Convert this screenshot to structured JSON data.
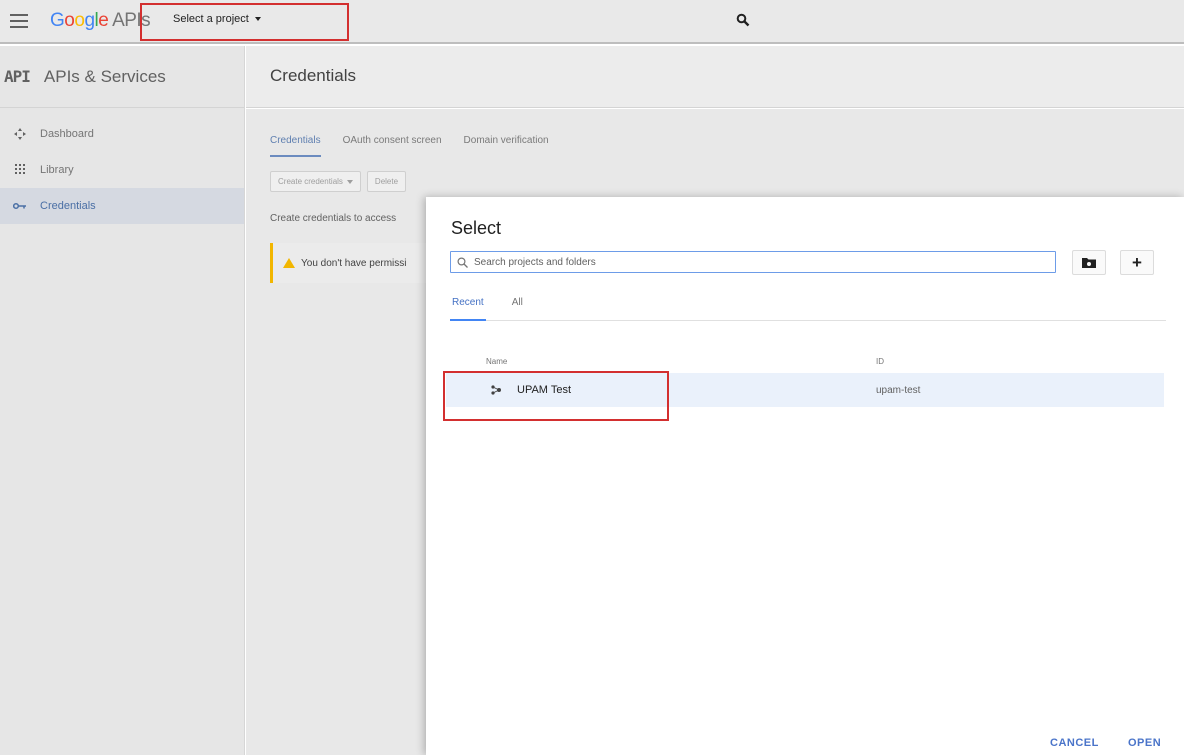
{
  "header": {
    "brand_google": [
      "G",
      "o",
      "o",
      "g",
      "l",
      "e"
    ],
    "brand_suffix": "APIs",
    "project_picker_label": "Select a project"
  },
  "sidebar": {
    "logo_text": "API",
    "title": "APIs & Services",
    "items": [
      {
        "label": "Dashboard",
        "icon": "dashboard-icon"
      },
      {
        "label": "Library",
        "icon": "library-icon"
      },
      {
        "label": "Credentials",
        "icon": "key-icon",
        "active": true
      }
    ]
  },
  "main": {
    "title": "Credentials",
    "tabs": [
      "Credentials",
      "OAuth consent screen",
      "Domain verification"
    ],
    "active_tab": "Credentials",
    "toolbar": {
      "create_label": "Create credentials",
      "delete_label": "Delete"
    },
    "hint": "Create credentials to access",
    "warning": "You don't have permissi"
  },
  "dialog": {
    "title": "Select",
    "search": {
      "placeholder": "Search projects and folders",
      "value": ""
    },
    "tabs": [
      "Recent",
      "All"
    ],
    "active_tab": "Recent",
    "columns": {
      "name": "Name",
      "id": "ID"
    },
    "projects": [
      {
        "name": "UPAM Test",
        "id": "upam-test"
      }
    ],
    "actions": {
      "cancel": "CANCEL",
      "open": "OPEN"
    }
  },
  "colors": {
    "accent": "#4285f4",
    "highlight": "#d32f2f",
    "warning": "#f2b600"
  }
}
